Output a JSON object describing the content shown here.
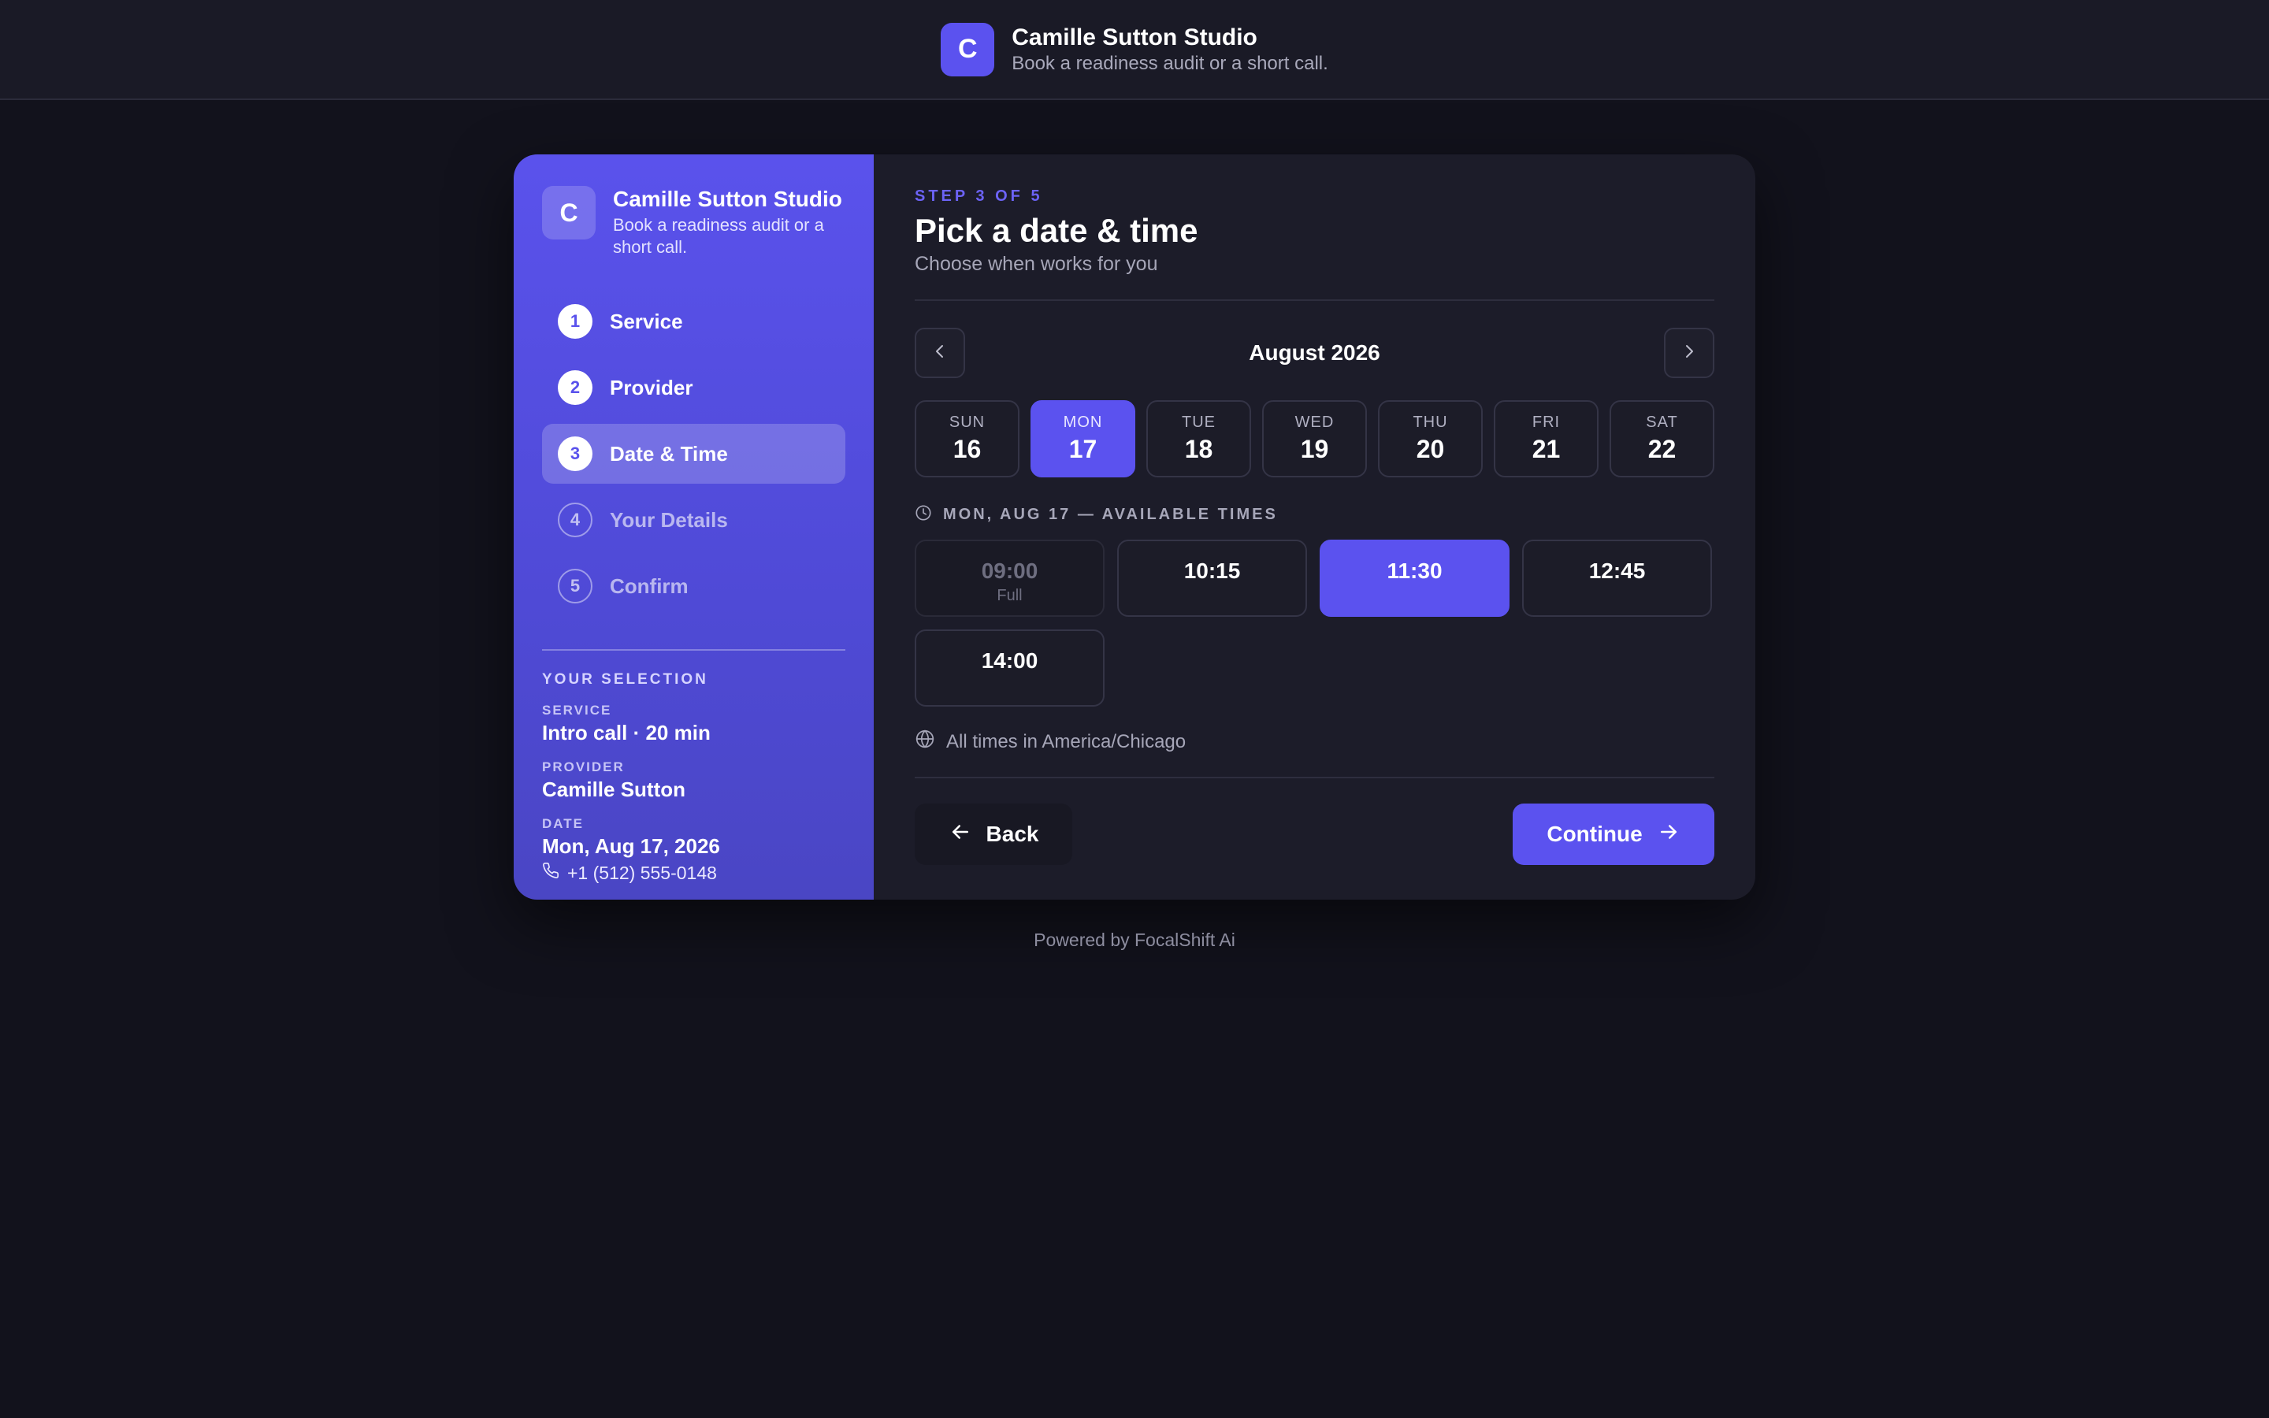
{
  "header": {
    "logo_letter": "C",
    "title": "Camille Sutton Studio",
    "subtitle": "Book a readiness audit or a short call."
  },
  "sidebar": {
    "logo_letter": "C",
    "title": "Camille Sutton Studio",
    "subtitle": "Book a readiness audit or a short call.",
    "steps": [
      {
        "num": "1",
        "label": "Service",
        "state": "done"
      },
      {
        "num": "2",
        "label": "Provider",
        "state": "done"
      },
      {
        "num": "3",
        "label": "Date & Time",
        "state": "active"
      },
      {
        "num": "4",
        "label": "Your Details",
        "state": "todo"
      },
      {
        "num": "5",
        "label": "Confirm",
        "state": "todo"
      }
    ],
    "selection": {
      "heading": "YOUR SELECTION",
      "service_key": "SERVICE",
      "service_value": "Intro call · 20 min",
      "provider_key": "PROVIDER",
      "provider_value": "Camille Sutton",
      "date_key": "DATE",
      "date_value": "Mon, Aug 17, 2026",
      "phone": "+1 (512) 555-0148"
    }
  },
  "main": {
    "step_tag": "STEP 3 OF 5",
    "title": "Pick a date & time",
    "subtitle": "Choose when works for you",
    "month": "August 2026",
    "days": [
      {
        "dow": "SUN",
        "num": "16",
        "selected": false
      },
      {
        "dow": "MON",
        "num": "17",
        "selected": true
      },
      {
        "dow": "TUE",
        "num": "18",
        "selected": false
      },
      {
        "dow": "WED",
        "num": "19",
        "selected": false
      },
      {
        "dow": "THU",
        "num": "20",
        "selected": false
      },
      {
        "dow": "FRI",
        "num": "21",
        "selected": false
      },
      {
        "dow": "SAT",
        "num": "22",
        "selected": false
      }
    ],
    "available_label": "MON, AUG 17 — AVAILABLE TIMES",
    "times": [
      {
        "time": "09:00",
        "note": "Full",
        "state": "full"
      },
      {
        "time": "10:15",
        "note": "",
        "state": "open"
      },
      {
        "time": "11:30",
        "note": "",
        "state": "selected"
      },
      {
        "time": "12:45",
        "note": "",
        "state": "open"
      },
      {
        "time": "14:00",
        "note": "",
        "state": "open"
      }
    ],
    "timezone_note": "All times in America/Chicago",
    "back_label": "Back",
    "continue_label": "Continue"
  },
  "footer": {
    "text": "Powered by FocalShift Ai"
  },
  "colors": {
    "accent": "#5b52ef",
    "background": "#12121c",
    "panel": "#1c1c29"
  }
}
